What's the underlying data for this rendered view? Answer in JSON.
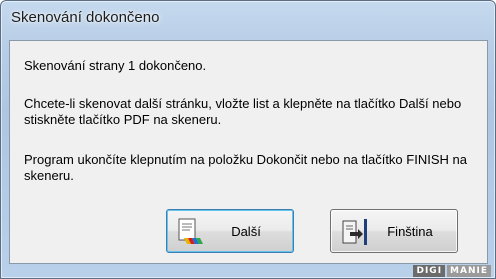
{
  "window": {
    "title": "Skenování dokončeno"
  },
  "messages": {
    "line1": "Skenování strany 1 dokončeno.",
    "line2a": "Chcete-li skenovat další stránku, vložte list a klepněte na tlačítko Další nebo",
    "line2b": "stiskněte tlačítko PDF na skeneru.",
    "line3a": "Program ukončíte klepnutím na položku Dokončit nebo na tlačítko FINISH na",
    "line3b": "skeneru."
  },
  "buttons": {
    "next_label": "Další",
    "finish_label": "Finština"
  },
  "watermark": {
    "part1": "DIGI",
    "part2": "MANIE"
  },
  "icons": {
    "next": "scan-next-page-icon",
    "finish": "exit-door-icon"
  }
}
